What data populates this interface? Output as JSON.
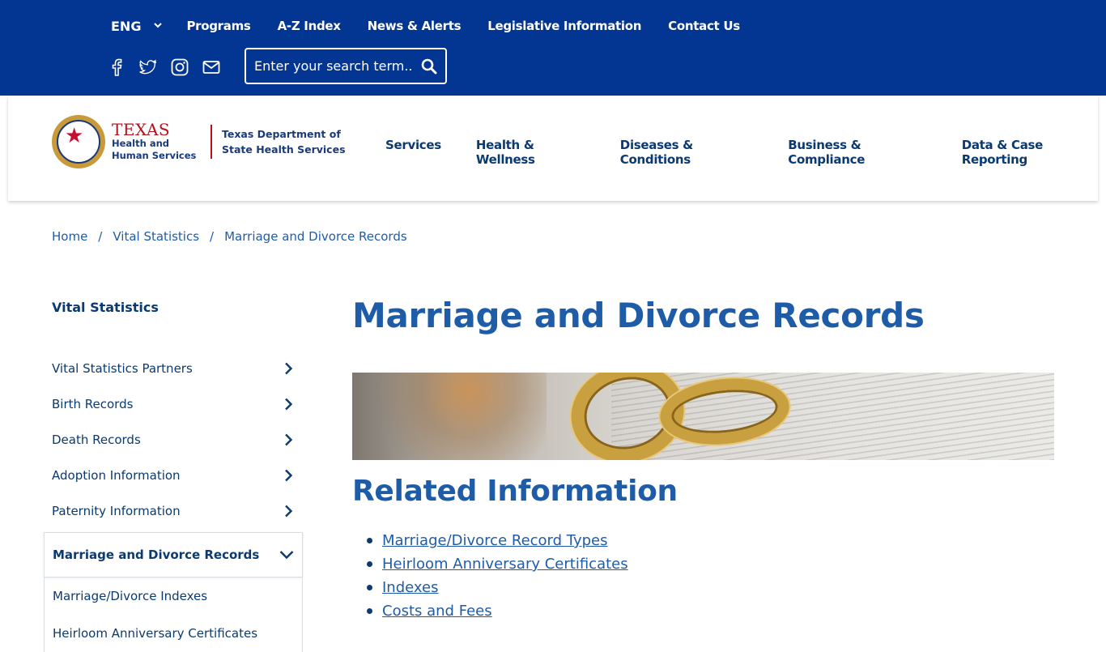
{
  "topbar": {
    "language": "ENG",
    "links": [
      "Programs",
      "A-Z Index",
      "News & Alerts",
      "Legislative Information",
      "Contact Us"
    ],
    "social_icons": [
      "facebook-icon",
      "twitter-icon",
      "instagram-icon",
      "email-icon"
    ],
    "search_placeholder": "Enter your search term..",
    "colors": {
      "background": "#033592",
      "text": "#ffffff"
    }
  },
  "header": {
    "logo_texas": "TEXAS",
    "logo_hhs": "Health and Human Services",
    "logo_dshs": "Texas Department of State Health Services",
    "nav": [
      "Services",
      "Health & Wellness",
      "Diseases & Conditions",
      "Business & Compliance",
      "Data & Case Reporting"
    ]
  },
  "breadcrumb": {
    "items": [
      "Home",
      "Vital Statistics",
      "Marriage and Divorce Records"
    ],
    "separator": "/"
  },
  "sidebar": {
    "title": "Vital Statistics",
    "items": [
      "Vital Statistics Partners",
      "Birth Records",
      "Death Records",
      "Adoption Information",
      "Paternity Information"
    ],
    "active": "Marriage and Divorce Records",
    "subitems": [
      "Marriage/Divorce Indexes",
      "Heirloom Anniversary Certificates"
    ]
  },
  "main": {
    "title": "Marriage and Divorce Records",
    "related_heading": "Related Information",
    "related_links": [
      "Marriage/Divorce Record Types",
      "Heirloom Anniversary Certificates",
      "Indexes",
      "Costs and Fees"
    ],
    "accent_color": "#1f5ca8"
  }
}
